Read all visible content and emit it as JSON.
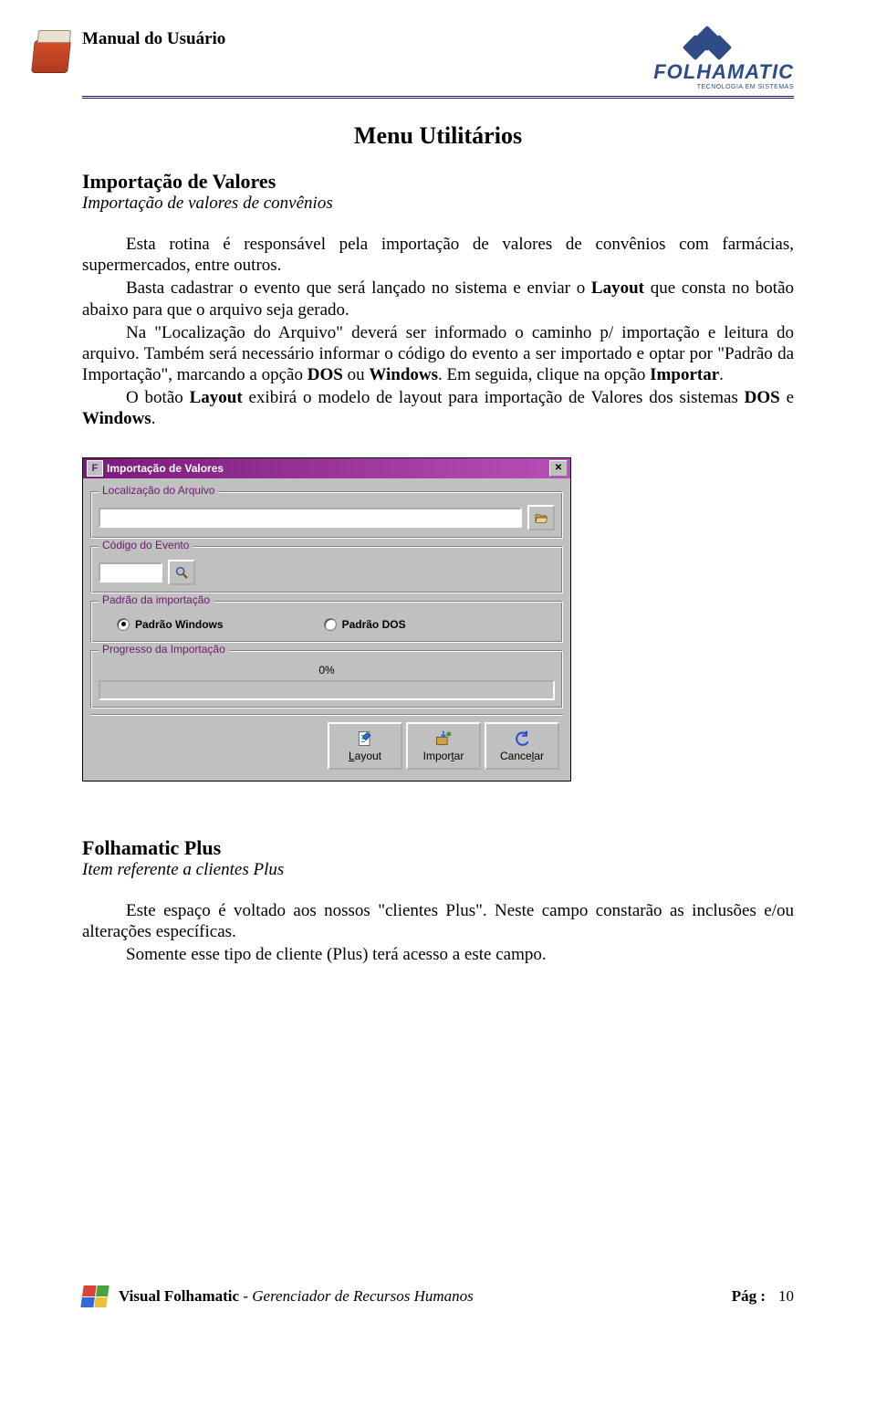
{
  "header": {
    "manual_title": "Manual do Usuário",
    "brand_name": "FOLHAMATIC",
    "brand_sub": "TECNOLOGIA EM SISTEMAS"
  },
  "page_heading": "Menu Utilitários",
  "section1": {
    "title": "Importação de Valores",
    "subtitle": "Importação de valores de convênios",
    "p1": "Esta rotina é responsável pela importação de valores de convênios com farmácias, supermercados, entre outros.",
    "p2a": "Basta cadastrar o evento que será lançado no sistema e enviar o ",
    "p2_layout": "Layout",
    "p2b": " que consta no botão abaixo para que o arquivo seja gerado.",
    "p3a": "Na \"Localização do Arquivo\" deverá ser informado o caminho p/ importação e leitura do arquivo. Também será necessário informar o código do evento a ser importado e optar por \"Padrão da Importação\", marcando a opção ",
    "p3_dos": "DOS",
    "p3_or": " ou ",
    "p3_win": "Windows",
    "p3b": ". Em seguida, clique na opção ",
    "p3_imp": "Importar",
    "p3c": ".",
    "p4a": "O botão ",
    "p4_layout": "Layout",
    "p4b": " exibirá o modelo de layout para importação de Valores dos sistemas ",
    "p4_dos": "DOS",
    "p4_and": " e ",
    "p4_win": "Windows",
    "p4c": "."
  },
  "dialog": {
    "title": "Importação de Valores",
    "group_loc": "Localização do Arquivo",
    "group_evt": "Código do Evento",
    "group_padrao": "Padrão da importação",
    "radio_win": "Padrão Windows",
    "radio_dos": "Padrão DOS",
    "group_prog": "Progresso da Importação",
    "progress_pct": "0%",
    "btn_layout": "Layout",
    "btn_importar": "Importar",
    "btn_cancelar": "Cancelar",
    "btn_layout_u": "L",
    "btn_layout_rest": "ayout",
    "btn_importar_pre": "Impor",
    "btn_importar_u": "t",
    "btn_importar_rest": "ar",
    "btn_cancelar_pre": "Cance",
    "btn_cancelar_u": "l",
    "btn_cancelar_rest": "ar"
  },
  "section2": {
    "title": "Folhamatic Plus",
    "subtitle": "Item referente a clientes Plus",
    "p1": "Este espaço é voltado aos nossos \"clientes Plus\". Neste campo constarão as inclusões e/ou alterações específicas.",
    "p2": "Somente esse tipo de cliente (Plus) terá acesso a este campo."
  },
  "footer": {
    "product_bold": "Visual Folhamatic",
    "product_sep": " - ",
    "product_italic": "Gerenciador de Recursos Humanos",
    "page_label": "Pág :",
    "page_number": "10"
  }
}
